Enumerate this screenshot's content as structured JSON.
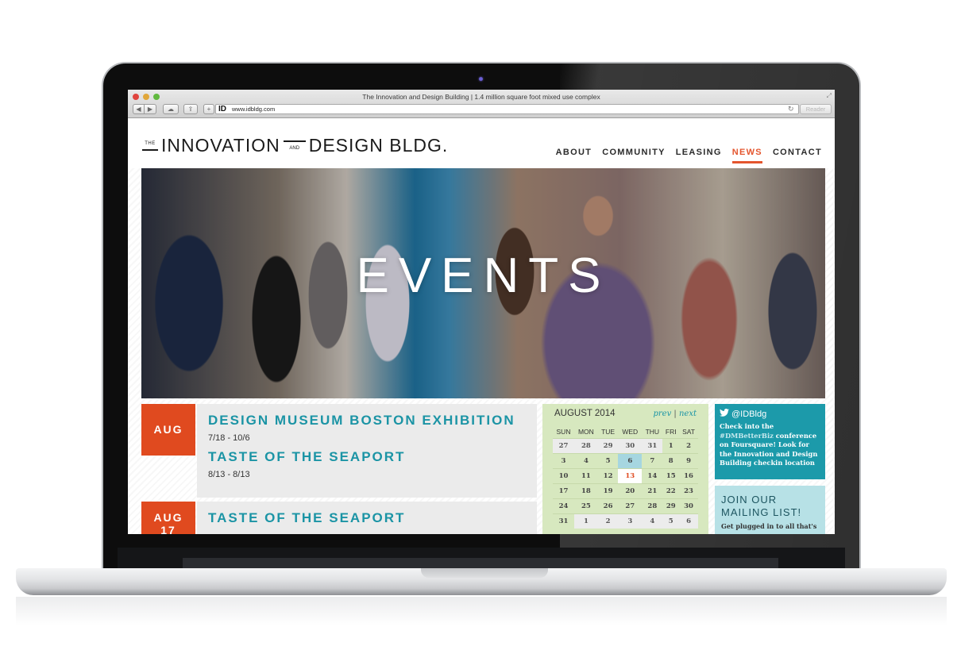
{
  "browser": {
    "window_title": "The Innovation and Design Building | 1.4 million square foot mixed use complex",
    "url": "www.idbldg.com",
    "favicon_text": "ID",
    "reader_label": "Reader",
    "icons": {
      "back": "◀",
      "forward": "▶",
      "icloud": "☁",
      "share": "⇪",
      "new_tab": "+",
      "reload": "↻",
      "fullscreen": "⤢"
    }
  },
  "site": {
    "logo": {
      "the": "THE",
      "word1": "INNOVATION",
      "and": "AND",
      "word2": "DESIGN BLDG."
    },
    "nav": [
      {
        "label": "ABOUT",
        "active": false
      },
      {
        "label": "COMMUNITY",
        "active": false
      },
      {
        "label": "LEASING",
        "active": false
      },
      {
        "label": "NEWS",
        "active": true
      },
      {
        "label": "CONTACT",
        "active": false
      }
    ],
    "hero_title": "EVENTS",
    "colors": {
      "accent_orange": "#e04a1f",
      "teal": "#1b94a5",
      "calendar_green": "#d7e8bf",
      "tweet_teal": "#1c9aaa",
      "mailing_bg": "#b7e1e6"
    }
  },
  "events": [
    {
      "month": "AUG",
      "day": "",
      "items": [
        {
          "title": "DESIGN MUSEUM BOSTON EXHIBITION",
          "dates": "7/18 - 10/6"
        },
        {
          "title": "TASTE OF THE SEAPORT",
          "dates": "8/13 - 8/13"
        }
      ]
    },
    {
      "month": "AUG",
      "day": "17",
      "items": [
        {
          "title": "TASTE OF THE SEAPORT",
          "dates": ""
        }
      ]
    }
  ],
  "calendar": {
    "title": "AUGUST 2014",
    "prev_label": "prev",
    "separator": "|",
    "next_label": "next",
    "weekdays": [
      "SUN",
      "MON",
      "TUE",
      "WED",
      "THU",
      "FRI",
      "SAT"
    ],
    "weeks": [
      [
        {
          "d": "27",
          "t": "other"
        },
        {
          "d": "28",
          "t": "other"
        },
        {
          "d": "29",
          "t": "other"
        },
        {
          "d": "30",
          "t": "other"
        },
        {
          "d": "31",
          "t": "other"
        },
        {
          "d": "1",
          "t": ""
        },
        {
          "d": "2",
          "t": ""
        }
      ],
      [
        {
          "d": "3",
          "t": ""
        },
        {
          "d": "4",
          "t": ""
        },
        {
          "d": "5",
          "t": ""
        },
        {
          "d": "6",
          "t": "event"
        },
        {
          "d": "7",
          "t": ""
        },
        {
          "d": "8",
          "t": ""
        },
        {
          "d": "9",
          "t": ""
        }
      ],
      [
        {
          "d": "10",
          "t": ""
        },
        {
          "d": "11",
          "t": ""
        },
        {
          "d": "12",
          "t": ""
        },
        {
          "d": "13",
          "t": "today"
        },
        {
          "d": "14",
          "t": ""
        },
        {
          "d": "15",
          "t": ""
        },
        {
          "d": "16",
          "t": ""
        }
      ],
      [
        {
          "d": "17",
          "t": ""
        },
        {
          "d": "18",
          "t": ""
        },
        {
          "d": "19",
          "t": ""
        },
        {
          "d": "20",
          "t": ""
        },
        {
          "d": "21",
          "t": ""
        },
        {
          "d": "22",
          "t": ""
        },
        {
          "d": "23",
          "t": ""
        }
      ],
      [
        {
          "d": "24",
          "t": ""
        },
        {
          "d": "25",
          "t": ""
        },
        {
          "d": "26",
          "t": ""
        },
        {
          "d": "27",
          "t": ""
        },
        {
          "d": "28",
          "t": ""
        },
        {
          "d": "29",
          "t": ""
        },
        {
          "d": "30",
          "t": ""
        }
      ],
      [
        {
          "d": "31",
          "t": ""
        },
        {
          "d": "1",
          "t": "other"
        },
        {
          "d": "2",
          "t": "other"
        },
        {
          "d": "3",
          "t": "other"
        },
        {
          "d": "4",
          "t": "other"
        },
        {
          "d": "5",
          "t": "other"
        },
        {
          "d": "6",
          "t": "other"
        }
      ]
    ]
  },
  "twitter": {
    "icon": "🐦",
    "handle": "@IDBldg",
    "text_before": "Check into the ",
    "hashtag": "#DMBetterBiz",
    "text_after": " conference on Foursquare! Look for the Innovation and Design Building checkin location"
  },
  "mailing": {
    "title_line1": "JOIN OUR",
    "title_line2": "MAILING LIST!",
    "text": "Get plugged in to all that's"
  }
}
